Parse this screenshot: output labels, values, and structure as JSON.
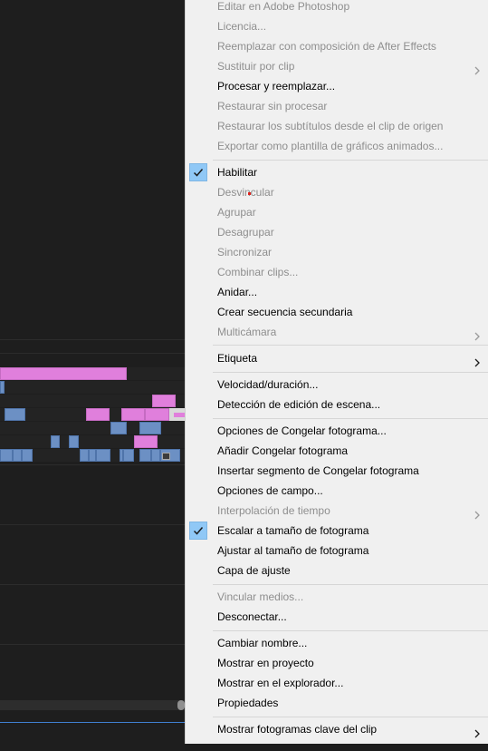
{
  "menu": {
    "items": [
      {
        "label": "Editar en Adobe Photoshop",
        "enabled": false,
        "checked": false,
        "submenu": false
      },
      {
        "label": "Licencia...",
        "enabled": false,
        "checked": false,
        "submenu": false
      },
      {
        "label": "Reemplazar con composición de After Effects",
        "enabled": false,
        "checked": false,
        "submenu": false
      },
      {
        "label": "Sustituir por clip",
        "enabled": false,
        "checked": false,
        "submenu": true
      },
      {
        "label": "Procesar y reemplazar...",
        "enabled": true,
        "checked": false,
        "submenu": false
      },
      {
        "label": "Restaurar sin procesar",
        "enabled": false,
        "checked": false,
        "submenu": false
      },
      {
        "label": "Restaurar los subtítulos desde el clip de origen",
        "enabled": false,
        "checked": false,
        "submenu": false
      },
      {
        "label": "Exportar como plantilla de gráficos animados...",
        "enabled": false,
        "checked": false,
        "submenu": false
      },
      {
        "label": "Habilitar",
        "enabled": true,
        "checked": true,
        "submenu": false
      },
      {
        "label": "Desvincular",
        "enabled": false,
        "checked": false,
        "submenu": false
      },
      {
        "label": "Agrupar",
        "enabled": false,
        "checked": false,
        "submenu": false
      },
      {
        "label": "Desagrupar",
        "enabled": false,
        "checked": false,
        "submenu": false
      },
      {
        "label": "Sincronizar",
        "enabled": false,
        "checked": false,
        "submenu": false
      },
      {
        "label": "Combinar clips...",
        "enabled": false,
        "checked": false,
        "submenu": false
      },
      {
        "label": "Anidar...",
        "enabled": true,
        "checked": false,
        "submenu": false
      },
      {
        "label": "Crear secuencia secundaria",
        "enabled": true,
        "checked": false,
        "submenu": false
      },
      {
        "label": "Multicámara",
        "enabled": false,
        "checked": false,
        "submenu": true
      },
      {
        "label": "Etiqueta",
        "enabled": true,
        "checked": false,
        "submenu": true
      },
      {
        "label": "Velocidad/duración...",
        "enabled": true,
        "checked": false,
        "submenu": false
      },
      {
        "label": "Detección de edición de escena...",
        "enabled": true,
        "checked": false,
        "submenu": false
      },
      {
        "label": "Opciones de Congelar fotograma...",
        "enabled": true,
        "checked": false,
        "submenu": false
      },
      {
        "label": "Añadir Congelar fotograma",
        "enabled": true,
        "checked": false,
        "submenu": false
      },
      {
        "label": "Insertar segmento de Congelar fotograma",
        "enabled": true,
        "checked": false,
        "submenu": false
      },
      {
        "label": "Opciones de campo...",
        "enabled": true,
        "checked": false,
        "submenu": false
      },
      {
        "label": "Interpolación de tiempo",
        "enabled": false,
        "checked": false,
        "submenu": true
      },
      {
        "label": "Escalar a tamaño de fotograma",
        "enabled": true,
        "checked": true,
        "submenu": false
      },
      {
        "label": "Ajustar al tamaño de fotograma",
        "enabled": true,
        "checked": false,
        "submenu": false
      },
      {
        "label": "Capa de ajuste",
        "enabled": true,
        "checked": false,
        "submenu": false
      },
      {
        "label": "Vincular medios...",
        "enabled": false,
        "checked": false,
        "submenu": false
      },
      {
        "label": "Desconectar...",
        "enabled": true,
        "checked": false,
        "submenu": false
      },
      {
        "label": "Cambiar nombre...",
        "enabled": true,
        "checked": false,
        "submenu": false
      },
      {
        "label": "Mostrar en proyecto",
        "enabled": true,
        "checked": false,
        "submenu": false
      },
      {
        "label": "Mostrar en el explorador...",
        "enabled": true,
        "checked": false,
        "submenu": false
      },
      {
        "label": "Propiedades",
        "enabled": true,
        "checked": false,
        "submenu": false
      },
      {
        "label": "Mostrar fotogramas clave del clip",
        "enabled": true,
        "checked": false,
        "submenu": true
      }
    ]
  },
  "icons": {
    "check": "check-icon",
    "submenu": "chevron-right-icon"
  },
  "colors": {
    "menu_background": "#f0f0f0",
    "disabled_text": "#8e8e8e",
    "check_highlight": "#90c8f6",
    "clip_pink": "#e07fdc",
    "clip_blue": "#6c90c4",
    "timeline_background": "#1e1e1e",
    "playhead": "#3f7fd1"
  }
}
